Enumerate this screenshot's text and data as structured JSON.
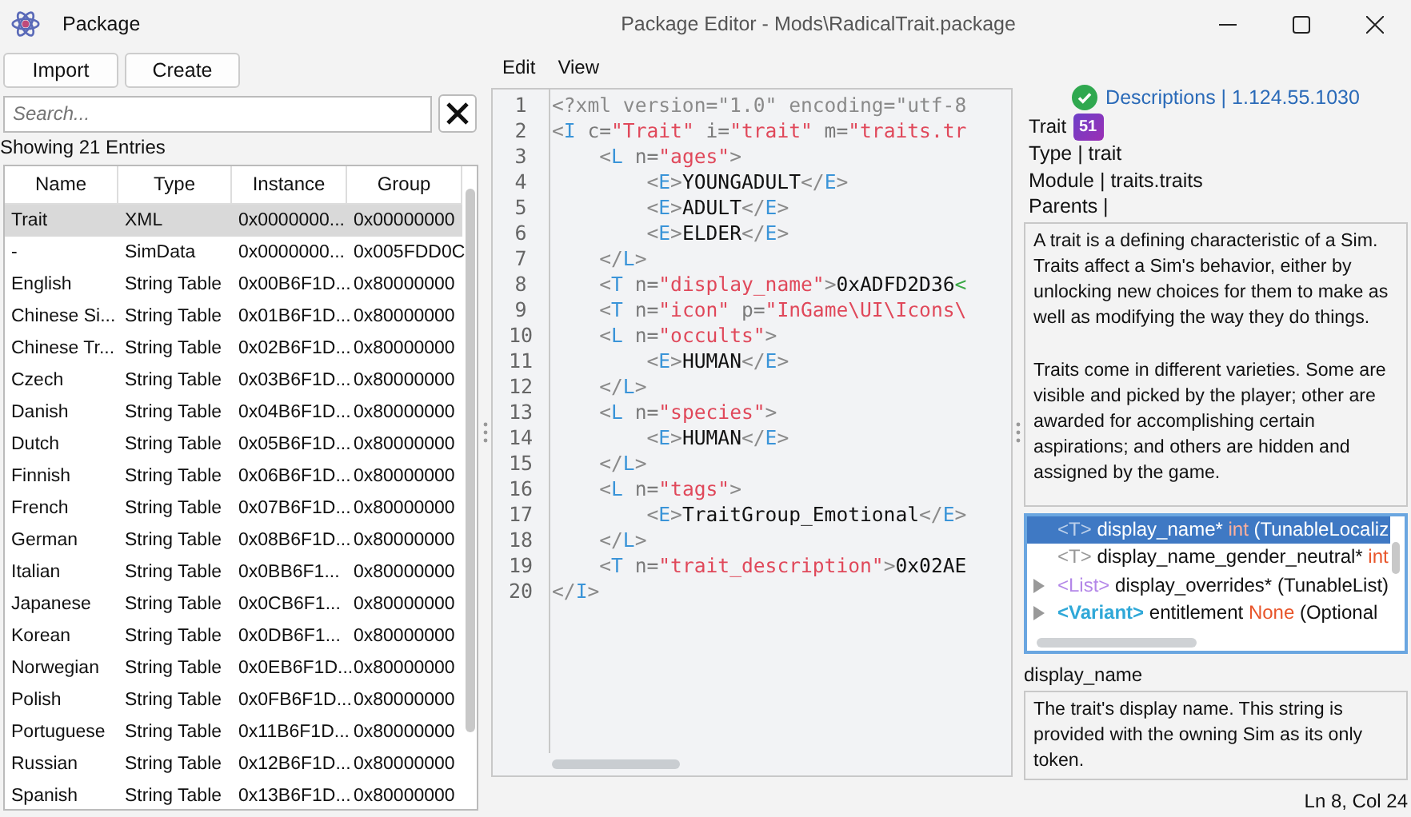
{
  "app": {
    "name": "Package"
  },
  "window": {
    "title": "Package Editor - Mods\\RadicalTrait.package"
  },
  "left": {
    "buttons": [
      "Import",
      "Create"
    ],
    "search": {
      "placeholder": "Search..."
    },
    "count": "Showing 21 Entries",
    "table": {
      "columns": [
        "Name",
        "Type",
        "Instance",
        "Group"
      ],
      "rows": [
        {
          "selected": true,
          "cells": [
            "Trait",
            "XML",
            "0x0000000...",
            "0x00000000"
          ]
        },
        {
          "selected": false,
          "cells": [
            "-",
            "SimData",
            "0x0000000...",
            "0x005FDD0C"
          ]
        },
        {
          "selected": false,
          "cells": [
            "English",
            "String Table",
            "0x00B6F1D...",
            "0x80000000"
          ]
        },
        {
          "selected": false,
          "cells": [
            "Chinese Si...",
            "String Table",
            "0x01B6F1D...",
            "0x80000000"
          ]
        },
        {
          "selected": false,
          "cells": [
            "Chinese Tr...",
            "String Table",
            "0x02B6F1D...",
            "0x80000000"
          ]
        },
        {
          "selected": false,
          "cells": [
            "Czech",
            "String Table",
            "0x03B6F1D...",
            "0x80000000"
          ]
        },
        {
          "selected": false,
          "cells": [
            "Danish",
            "String Table",
            "0x04B6F1D...",
            "0x80000000"
          ]
        },
        {
          "selected": false,
          "cells": [
            "Dutch",
            "String Table",
            "0x05B6F1D...",
            "0x80000000"
          ]
        },
        {
          "selected": false,
          "cells": [
            "Finnish",
            "String Table",
            "0x06B6F1D...",
            "0x80000000"
          ]
        },
        {
          "selected": false,
          "cells": [
            "French",
            "String Table",
            "0x07B6F1D...",
            "0x80000000"
          ]
        },
        {
          "selected": false,
          "cells": [
            "German",
            "String Table",
            "0x08B6F1D...",
            "0x80000000"
          ]
        },
        {
          "selected": false,
          "cells": [
            "Italian",
            "String Table",
            "0x0BB6F1...",
            "0x80000000"
          ]
        },
        {
          "selected": false,
          "cells": [
            "Japanese",
            "String Table",
            "0x0CB6F1...",
            "0x80000000"
          ]
        },
        {
          "selected": false,
          "cells": [
            "Korean",
            "String Table",
            "0x0DB6F1...",
            "0x80000000"
          ]
        },
        {
          "selected": false,
          "cells": [
            "Norwegian",
            "String Table",
            "0x0EB6F1D...",
            "0x80000000"
          ]
        },
        {
          "selected": false,
          "cells": [
            "Polish",
            "String Table",
            "0x0FB6F1D...",
            "0x80000000"
          ]
        },
        {
          "selected": false,
          "cells": [
            "Portuguese",
            "String Table",
            "0x11B6F1D...",
            "0x80000000"
          ]
        },
        {
          "selected": false,
          "cells": [
            "Russian",
            "String Table",
            "0x12B6F1D...",
            "0x80000000"
          ]
        },
        {
          "selected": false,
          "cells": [
            "Spanish",
            "String Table",
            "0x13B6F1D...",
            "0x80000000"
          ]
        }
      ]
    }
  },
  "editor": {
    "menu": [
      "Edit",
      "View"
    ],
    "lines": [
      {
        "number": "1",
        "tokens": [
          {
            "kind": "punct",
            "text": "<?xml version=\"1.0\" encoding=\"utf-8"
          }
        ]
      },
      {
        "number": "2",
        "tokens": [
          {
            "kind": "punct",
            "text": "<"
          },
          {
            "kind": "tag",
            "text": "I"
          },
          {
            "kind": "attr",
            "text": " c="
          },
          {
            "kind": "string",
            "text": "\"Trait\""
          },
          {
            "kind": "attr",
            "text": " i="
          },
          {
            "kind": "string",
            "text": "\"trait\""
          },
          {
            "kind": "attr",
            "text": " m="
          },
          {
            "kind": "string",
            "text": "\"traits.tr"
          }
        ]
      },
      {
        "number": "3",
        "tokens": [
          {
            "kind": "punct",
            "text": "    <"
          },
          {
            "kind": "tag",
            "text": "L"
          },
          {
            "kind": "attr",
            "text": " n="
          },
          {
            "kind": "string",
            "text": "\"ages\""
          },
          {
            "kind": "punct",
            "text": ">"
          }
        ]
      },
      {
        "number": "4",
        "tokens": [
          {
            "kind": "punct",
            "text": "        <"
          },
          {
            "kind": "tag",
            "text": "E"
          },
          {
            "kind": "punct",
            "text": ">"
          },
          {
            "kind": "text",
            "text": "YOUNGADULT"
          },
          {
            "kind": "punct",
            "text": "</"
          },
          {
            "kind": "tag",
            "text": "E"
          },
          {
            "kind": "punct",
            "text": ">"
          }
        ]
      },
      {
        "number": "5",
        "tokens": [
          {
            "kind": "punct",
            "text": "        <"
          },
          {
            "kind": "tag",
            "text": "E"
          },
          {
            "kind": "punct",
            "text": ">"
          },
          {
            "kind": "text",
            "text": "ADULT"
          },
          {
            "kind": "punct",
            "text": "</"
          },
          {
            "kind": "tag",
            "text": "E"
          },
          {
            "kind": "punct",
            "text": ">"
          }
        ]
      },
      {
        "number": "6",
        "tokens": [
          {
            "kind": "punct",
            "text": "        <"
          },
          {
            "kind": "tag",
            "text": "E"
          },
          {
            "kind": "punct",
            "text": ">"
          },
          {
            "kind": "text",
            "text": "ELDER"
          },
          {
            "kind": "punct",
            "text": "</"
          },
          {
            "kind": "tag",
            "text": "E"
          },
          {
            "kind": "punct",
            "text": ">"
          }
        ]
      },
      {
        "number": "7",
        "tokens": [
          {
            "kind": "punct",
            "text": "    </"
          },
          {
            "kind": "tag",
            "text": "L"
          },
          {
            "kind": "punct",
            "text": ">"
          }
        ]
      },
      {
        "number": "8",
        "tokens": [
          {
            "kind": "punct",
            "text": "    <"
          },
          {
            "kind": "tag",
            "text": "T"
          },
          {
            "kind": "attr",
            "text": " n="
          },
          {
            "kind": "string",
            "text": "\"display_name\""
          },
          {
            "kind": "punct",
            "text": ">"
          },
          {
            "kind": "text",
            "text": "0xADFD2D36"
          },
          {
            "kind": "close",
            "text": "<"
          }
        ]
      },
      {
        "number": "9",
        "tokens": [
          {
            "kind": "punct",
            "text": "    <"
          },
          {
            "kind": "tag",
            "text": "T"
          },
          {
            "kind": "attr",
            "text": " n="
          },
          {
            "kind": "string",
            "text": "\"icon\""
          },
          {
            "kind": "attr",
            "text": " p="
          },
          {
            "kind": "string",
            "text": "\"InGame\\UI\\Icons\\"
          }
        ]
      },
      {
        "number": "10",
        "tokens": [
          {
            "kind": "punct",
            "text": "    <"
          },
          {
            "kind": "tag",
            "text": "L"
          },
          {
            "kind": "attr",
            "text": " n="
          },
          {
            "kind": "string",
            "text": "\"occults\""
          },
          {
            "kind": "punct",
            "text": ">"
          }
        ]
      },
      {
        "number": "11",
        "tokens": [
          {
            "kind": "punct",
            "text": "        <"
          },
          {
            "kind": "tag",
            "text": "E"
          },
          {
            "kind": "punct",
            "text": ">"
          },
          {
            "kind": "text",
            "text": "HUMAN"
          },
          {
            "kind": "punct",
            "text": "</"
          },
          {
            "kind": "tag",
            "text": "E"
          },
          {
            "kind": "punct",
            "text": ">"
          }
        ]
      },
      {
        "number": "12",
        "tokens": [
          {
            "kind": "punct",
            "text": "    </"
          },
          {
            "kind": "tag",
            "text": "L"
          },
          {
            "kind": "punct",
            "text": ">"
          }
        ]
      },
      {
        "number": "13",
        "tokens": [
          {
            "kind": "punct",
            "text": "    <"
          },
          {
            "kind": "tag",
            "text": "L"
          },
          {
            "kind": "attr",
            "text": " n="
          },
          {
            "kind": "string",
            "text": "\"species\""
          },
          {
            "kind": "punct",
            "text": ">"
          }
        ]
      },
      {
        "number": "14",
        "tokens": [
          {
            "kind": "punct",
            "text": "        <"
          },
          {
            "kind": "tag",
            "text": "E"
          },
          {
            "kind": "punct",
            "text": ">"
          },
          {
            "kind": "text",
            "text": "HUMAN"
          },
          {
            "kind": "punct",
            "text": "</"
          },
          {
            "kind": "tag",
            "text": "E"
          },
          {
            "kind": "punct",
            "text": ">"
          }
        ]
      },
      {
        "number": "15",
        "tokens": [
          {
            "kind": "punct",
            "text": "    </"
          },
          {
            "kind": "tag",
            "text": "L"
          },
          {
            "kind": "punct",
            "text": ">"
          }
        ]
      },
      {
        "number": "16",
        "tokens": [
          {
            "kind": "punct",
            "text": "    <"
          },
          {
            "kind": "tag",
            "text": "L"
          },
          {
            "kind": "attr",
            "text": " n="
          },
          {
            "kind": "string",
            "text": "\"tags\""
          },
          {
            "kind": "punct",
            "text": ">"
          }
        ]
      },
      {
        "number": "17",
        "tokens": [
          {
            "kind": "punct",
            "text": "        <"
          },
          {
            "kind": "tag",
            "text": "E"
          },
          {
            "kind": "punct",
            "text": ">"
          },
          {
            "kind": "text",
            "text": "TraitGroup_Emotional"
          },
          {
            "kind": "punct",
            "text": "</"
          },
          {
            "kind": "tag",
            "text": "E"
          },
          {
            "kind": "punct",
            "text": ">"
          }
        ]
      },
      {
        "number": "18",
        "tokens": [
          {
            "kind": "punct",
            "text": "    </"
          },
          {
            "kind": "tag",
            "text": "L"
          },
          {
            "kind": "punct",
            "text": ">"
          }
        ]
      },
      {
        "number": "19",
        "tokens": [
          {
            "kind": "punct",
            "text": "    <"
          },
          {
            "kind": "tag",
            "text": "T"
          },
          {
            "kind": "attr",
            "text": " n="
          },
          {
            "kind": "string",
            "text": "\"trait_description\""
          },
          {
            "kind": "punct",
            "text": ">"
          },
          {
            "kind": "text",
            "text": "0x02AE"
          }
        ]
      },
      {
        "number": "20",
        "tokens": [
          {
            "kind": "punct",
            "text": "</"
          },
          {
            "kind": "tag",
            "text": "I"
          },
          {
            "kind": "punct",
            "text": ">"
          }
        ]
      }
    ]
  },
  "info": {
    "status_link": "Descriptions | 1.124.55.1030",
    "class_name": "Trait",
    "badge": "51",
    "type": "Type | trait",
    "module": "Module | traits.traits",
    "parents": "Parents |",
    "description": [
      "A trait is a defining characteristic of a Sim. Traits affect a Sim's behavior, either by unlocking new choices for them to make as well as modifying the way they do things.",
      "Traits come in different varieties. Some are visible and picked by the player; other are awarded for accomplishing certain aspirations; and others are hidden and assigned by the game."
    ],
    "tree": [
      {
        "selected": true,
        "has_children": false,
        "kind": "tunable",
        "tag": "<T>",
        "name": "display_name*",
        "value": "int",
        "detail": "(TunableLocaliz"
      },
      {
        "selected": false,
        "has_children": false,
        "kind": "tunable",
        "tag": "<T>",
        "name": "display_name_gender_neutral*",
        "value": "int"
      },
      {
        "selected": false,
        "has_children": true,
        "kind": "list",
        "tag": "<List>",
        "name": "display_overrides*",
        "detail": "(TunableList)"
      },
      {
        "selected": false,
        "has_children": true,
        "kind": "variant",
        "tag": "<Variant>",
        "name": "entitlement",
        "value": "None",
        "detail": "(Optional"
      }
    ],
    "field_name": "display_name",
    "field_doc": "The trait's display name. This string is provided with the owning Sim as its only token."
  },
  "status_bar": "Ln 8, Col 24"
}
